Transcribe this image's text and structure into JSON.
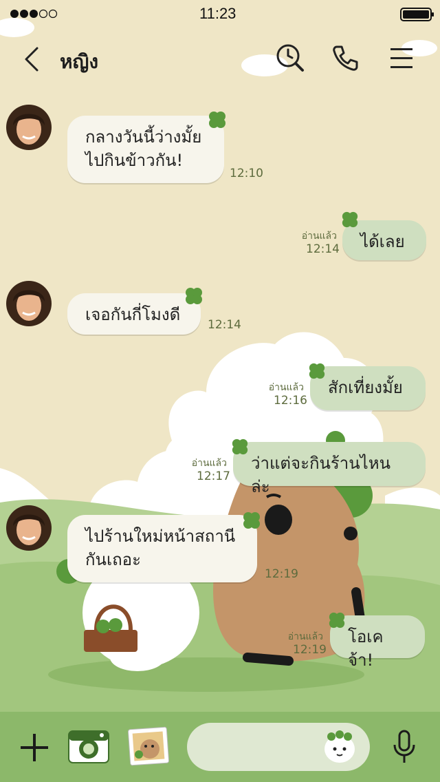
{
  "status_bar": {
    "time": "11:23"
  },
  "header": {
    "title": "หญิง"
  },
  "messages": [
    {
      "side": "in",
      "lines": [
        "กลางวันนี้ว่างมั้ย",
        "ไปกินข้าวกัน!"
      ],
      "time": "12:10"
    },
    {
      "side": "out",
      "text": "ได้เลย",
      "read": "อ่านแล้ว",
      "time": "12:14"
    },
    {
      "side": "in",
      "text": "เจอกันกี่โมงดี",
      "time": "12:14"
    },
    {
      "side": "out",
      "text": "สักเที่ยงมั้ย",
      "read": "อ่านแล้ว",
      "time": "12:16"
    },
    {
      "side": "out",
      "text": "ว่าแต่จะกินร้านไหนล่ะ",
      "read": "อ่านแล้ว",
      "time": "12:17"
    },
    {
      "side": "in",
      "lines": [
        "ไปร้านใหม่หน้าสถานี",
        "กันเถอะ"
      ],
      "time": "12:19"
    },
    {
      "side": "out",
      "text": "โอเคจ้า!",
      "read": "อ่านแล้ว",
      "time": "12:19"
    }
  ],
  "colors": {
    "sky": "#efe6c6",
    "grass": "#a8c882",
    "toolbar": "#8cb86a",
    "bubble_out": "#cfdfc0",
    "bubble_in": "#f7f5ec"
  },
  "icons": [
    "back-icon",
    "search-icon",
    "phone-icon",
    "menu-icon",
    "plus-icon",
    "camera-icon",
    "photo-icon",
    "sticker-icon",
    "mic-icon"
  ]
}
